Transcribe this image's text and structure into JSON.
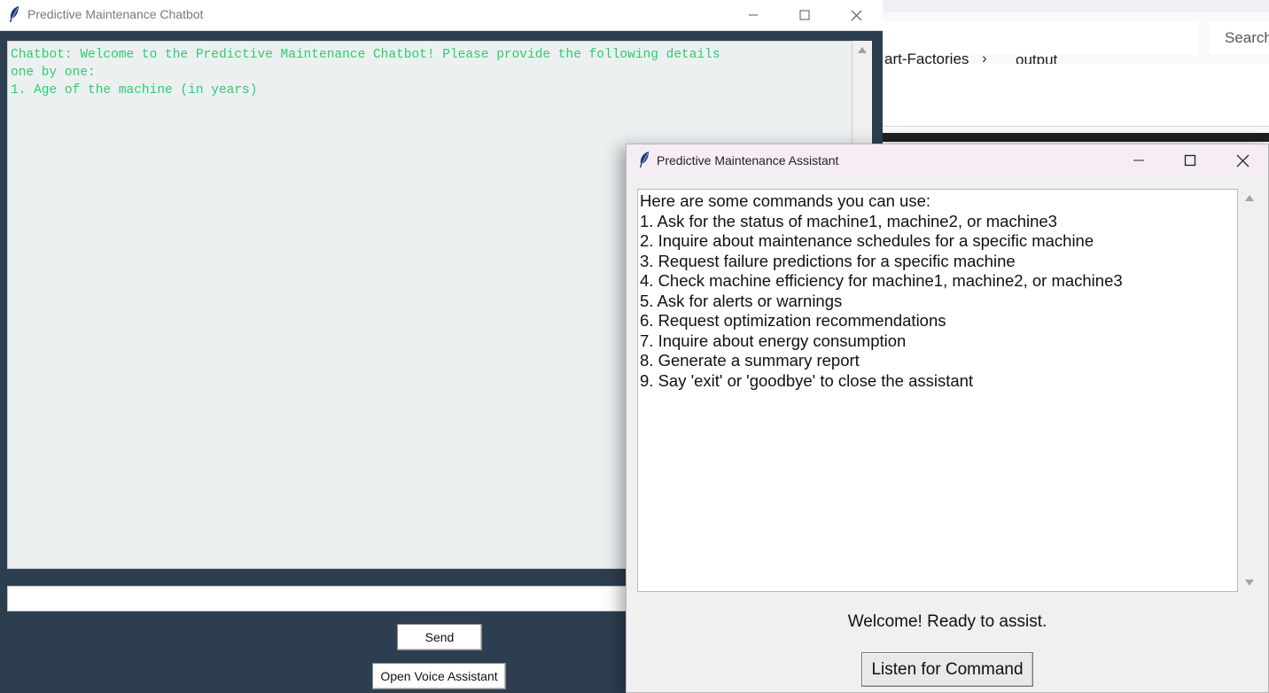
{
  "explorer": {
    "breadcrumb": [
      "art-Factories",
      "output"
    ],
    "breadcrumb_separator": "›",
    "search_label": "Search"
  },
  "chatbot_window": {
    "title": "Predictive Maintenance Chatbot",
    "chat_log": "Chatbot: Welcome to the Predictive Maintenance Chatbot! Please provide the following details\none by one:\n1. Age of the machine (in years)",
    "message_input_value": "",
    "send_label": "Send",
    "voice_label": "Open Voice Assistant",
    "text_color": "#2ecc71",
    "background": "#2c3e50"
  },
  "assistant_window": {
    "title": "Predictive Maintenance Assistant",
    "commands": [
      "Here are some commands you can use:",
      "1. Ask for the status of machine1, machine2, or machine3",
      "2. Inquire about maintenance schedules for a specific machine",
      "3. Request failure predictions for a specific machine",
      "4. Check machine efficiency for machine1, machine2, or machine3",
      "5. Ask for alerts or warnings",
      "6. Request optimization recommendations",
      "7. Inquire about energy consumption",
      "8. Generate a summary report",
      "9. Say 'exit' or 'goodbye' to close the assistant"
    ],
    "status": "Welcome! Ready to assist.",
    "listen_label": "Listen for Command"
  },
  "icons": [
    "feather-icon",
    "minimize-icon",
    "maximize-icon",
    "close-icon",
    "chevron-right-icon",
    "scroll-up-icon",
    "scroll-down-icon"
  ]
}
